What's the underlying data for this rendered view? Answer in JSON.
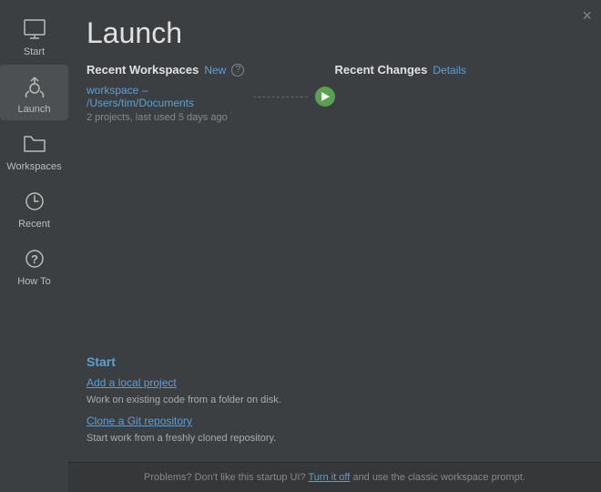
{
  "sidebar": {
    "items": [
      {
        "id": "start",
        "label": "Start",
        "active": false
      },
      {
        "id": "launch",
        "label": "Launch",
        "active": true
      },
      {
        "id": "workspaces",
        "label": "Workspaces",
        "active": false
      },
      {
        "id": "recent",
        "label": "Recent",
        "active": false
      },
      {
        "id": "howto",
        "label": "How To",
        "active": false
      }
    ]
  },
  "page": {
    "title": "Launch",
    "close_label": "×"
  },
  "recent_workspaces": {
    "section_title": "Recent Workspaces",
    "new_link": "New",
    "workspace_path": "workspace – /Users/tim/Documents",
    "workspace_meta": "2 projects, last used 5 days ago"
  },
  "recent_changes": {
    "section_title": "Recent Changes",
    "details_link": "Details"
  },
  "start_section": {
    "label": "Start",
    "actions": [
      {
        "link_text": "Add a local project",
        "description": "Work on existing code from a folder on disk."
      },
      {
        "link_text": "Clone a Git repository",
        "description": "Start work from a freshly cloned repository."
      }
    ]
  },
  "footer": {
    "text_before": "Problems? Don't like this startup UI?",
    "link_text": "Turn it off",
    "text_after": "and use the classic workspace prompt."
  }
}
